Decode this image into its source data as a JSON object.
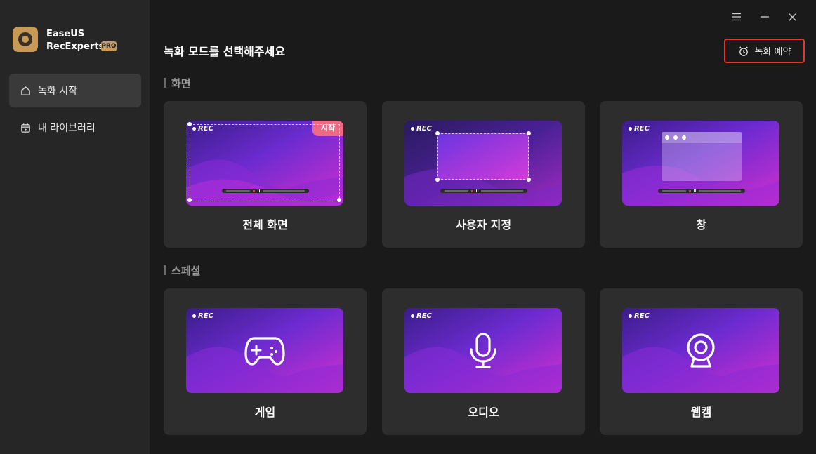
{
  "app": {
    "brand_line1": "EaseUS",
    "brand_line2": "RecExperts",
    "pro_badge": "PRO"
  },
  "sidebar": {
    "items": [
      {
        "label": "녹화 시작",
        "icon": "home-icon",
        "active": true
      },
      {
        "label": "내 라이브러리",
        "icon": "library-icon",
        "active": false
      }
    ]
  },
  "window_controls": {
    "menu": "menu-icon",
    "minimize": "minimize-icon",
    "close": "close-icon"
  },
  "header": {
    "title": "녹화 모드를 선택해주세요",
    "schedule_button": "녹화 예약"
  },
  "sections": [
    {
      "title": "화면",
      "cards": [
        {
          "label": "전체 화면",
          "rec": "REC",
          "badge": "시작"
        },
        {
          "label": "사용자 지정",
          "rec": "REC"
        },
        {
          "label": "창",
          "rec": "REC"
        }
      ]
    },
    {
      "title": "스페셜",
      "cards": [
        {
          "label": "게임",
          "rec": "REC",
          "icon": "gamepad-icon"
        },
        {
          "label": "오디오",
          "rec": "REC",
          "icon": "microphone-icon"
        },
        {
          "label": "웹캠",
          "rec": "REC",
          "icon": "webcam-icon"
        }
      ]
    }
  ],
  "colors": {
    "accent": "#e0392e",
    "badge": "#ee6b86",
    "brand": "#c79a57"
  }
}
